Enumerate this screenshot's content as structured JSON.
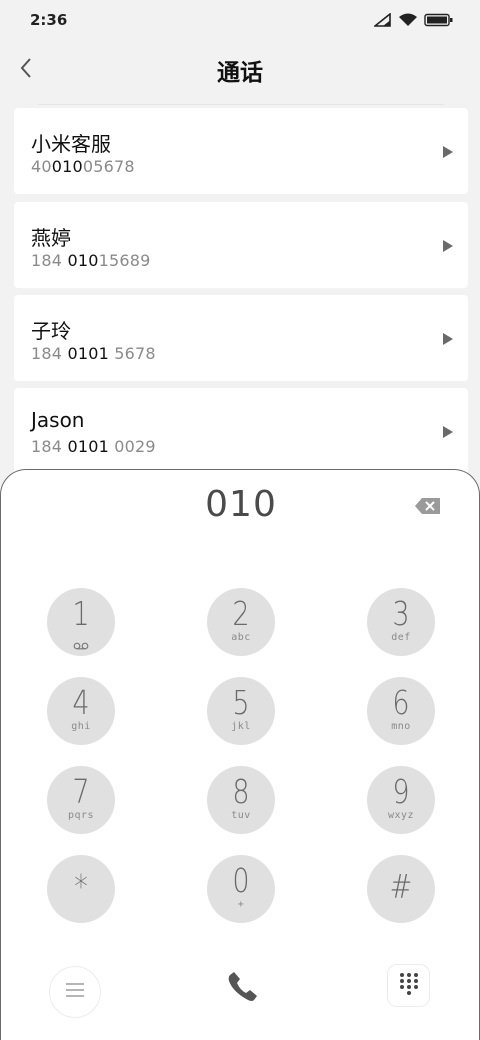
{
  "status": {
    "time": "2:36"
  },
  "header": {
    "title": "通话"
  },
  "contacts": [
    {
      "name": "小米客服",
      "pre": "40",
      "match": "010",
      "post": "05678"
    },
    {
      "name": "燕婷",
      "pre": "184 ",
      "match": "010",
      "post": "15689"
    },
    {
      "name": "子玲",
      "pre": "184 ",
      "match": "0101",
      "post": " 5678"
    },
    {
      "name": "Jason",
      "pre": "184 ",
      "match": "0101",
      "post": " 0029"
    }
  ],
  "dialer": {
    "input": "010",
    "keys": [
      {
        "digit": "1",
        "letters": ""
      },
      {
        "digit": "2",
        "letters": "abc"
      },
      {
        "digit": "3",
        "letters": "def"
      },
      {
        "digit": "4",
        "letters": "ghi"
      },
      {
        "digit": "5",
        "letters": "jkl"
      },
      {
        "digit": "6",
        "letters": "mno"
      },
      {
        "digit": "7",
        "letters": "pqrs"
      },
      {
        "digit": "8",
        "letters": "tuv"
      },
      {
        "digit": "9",
        "letters": "wxyz"
      },
      {
        "digit": "*",
        "letters": ""
      },
      {
        "digit": "0",
        "letters": "+"
      },
      {
        "digit": "#",
        "letters": ""
      }
    ]
  },
  "icons": {
    "status": [
      "signal-icon",
      "wifi-icon",
      "battery-icon"
    ],
    "back": "chevron-left-icon",
    "row_action": "play-arrow-icon",
    "backspace": "backspace-icon",
    "voicemail": "voicemail-icon",
    "menu": "menu-icon",
    "call": "phone-icon",
    "keypad": "dialpad-icon"
  }
}
